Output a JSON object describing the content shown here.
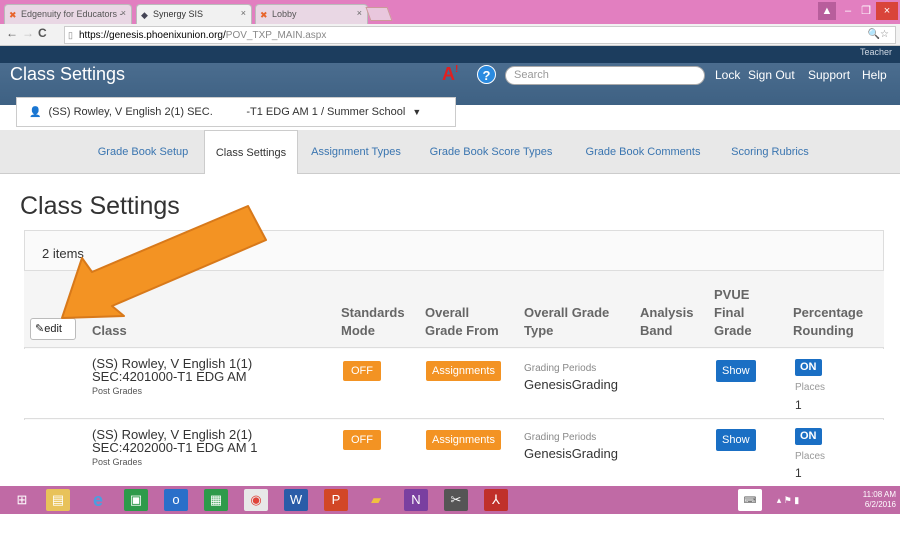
{
  "browser": {
    "tabs": [
      {
        "title": "Edgenuity for Educators -",
        "active": false
      },
      {
        "title": "Synergy SIS",
        "active": true
      },
      {
        "title": "Lobby",
        "active": false
      }
    ],
    "url_domain": "https://genesis.phoenixunion.org/",
    "url_path": "POV_TXP_MAIN.aspx"
  },
  "header": {
    "role": "Teacher",
    "title": "Class Settings",
    "search_placeholder": "Search",
    "links": [
      "Lock",
      "Sign Out",
      "Support",
      "Help"
    ]
  },
  "selector": {
    "label": "(SS) Rowley, V English 2(1) SEC.           -T1 EDG AM 1 / Summer School"
  },
  "tabs": [
    {
      "label": "Grade Book Setup",
      "active": false
    },
    {
      "label": "Class Settings",
      "active": true
    },
    {
      "label": "Assignment Types",
      "active": false
    },
    {
      "label": "Grade Book Score Types",
      "active": false
    },
    {
      "label": "Grade Book Comments",
      "active": false
    },
    {
      "label": "Scoring Rubrics",
      "active": false
    }
  ],
  "page": {
    "title": "Class Settings",
    "item_count": "2 items",
    "edit_label": "edit"
  },
  "columns": {
    "class": "Class",
    "standards_mode_1": "Standards",
    "standards_mode_2": "Mode",
    "overall_grade_from_1": "Overall",
    "overall_grade_from_2": "Grade From",
    "overall_grade_type_1": "Overall Grade",
    "overall_grade_type_2": "Type",
    "analysis_band_1": "Analysis",
    "analysis_band_2": "Band",
    "pvue_1": "PVUE",
    "pvue_2": "Final",
    "pvue_3": "Grade",
    "rounding_1": "Percentage",
    "rounding_2": "Rounding"
  },
  "rows": [
    {
      "class_line1": "(SS) Rowley, V English 1(1)",
      "class_line2": "SEC:4201000-T1 EDG AM",
      "class_line3": "Post Grades",
      "standards_mode": "OFF",
      "grade_from": "Assignments",
      "grade_type_label": "Grading Periods",
      "grade_type_value": "GenesisGrading",
      "pvue": "Show",
      "rounding": "ON",
      "places_label": "Places",
      "places_value": "1"
    },
    {
      "class_line1": "(SS) Rowley, V English 2(1)",
      "class_line2": "SEC:4202000-T1 EDG AM 1",
      "class_line3": "Post Grades",
      "standards_mode": "OFF",
      "grade_from": "Assignments",
      "grade_type_label": "Grading Periods",
      "grade_type_value": "GenesisGrading",
      "pvue": "Show",
      "rounding": "ON",
      "places_label": "Places",
      "places_value": "1"
    }
  ],
  "taskbar": {
    "time": "11:08 AM",
    "date": "6/2/2016"
  },
  "colors": {
    "header_bg": "#3e6183",
    "orange_badge": "#f39323",
    "blue_badge": "#1a6fc4",
    "arrow": "#f39323",
    "tab_strip": "#e27fc0"
  }
}
